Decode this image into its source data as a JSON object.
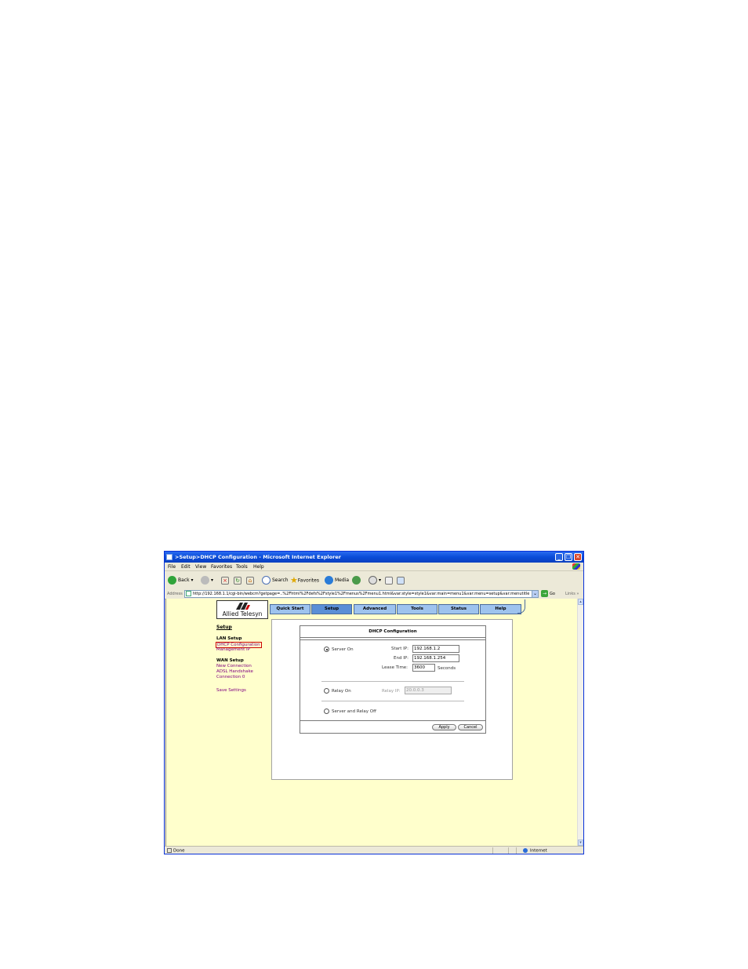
{
  "window": {
    "title": ">Setup>DHCP Configuration - Microsoft Internet Explorer",
    "minimize": "_",
    "maximize": "❐",
    "close": "✕"
  },
  "menubar": {
    "items": [
      "File",
      "Edit",
      "View",
      "Favorites",
      "Tools",
      "Help"
    ]
  },
  "toolbar": {
    "back": "Back",
    "search": "Search",
    "favorites": "Favorites",
    "media": "Media"
  },
  "address": {
    "label": "Address",
    "url": "http://192.168.1.1/cgi-bin/webcm?getpage=..%2Fhtml%2Fdefs%2Fstyle1%2Fmenus%2Fmenu1.html&var:style=style1&var:main=menu1&var:menu=setup&var:menutitle",
    "go": "Go",
    "links": "Links »"
  },
  "logo": {
    "brand": "Allied Telesyn"
  },
  "nav": {
    "tabs": [
      "Quick Start",
      "Setup",
      "Advanced",
      "Tools",
      "Status",
      "Help"
    ],
    "active_index": 1
  },
  "sidebar": {
    "title": "Setup",
    "lan_heading": "LAN Setup",
    "dhcp_link": "DHCP Configuration",
    "mgmt_link": "Management IP",
    "wan_heading": "WAN Setup",
    "new_conn": "New Connection",
    "adsl": "ADSL Handshake",
    "conn0": "Connection 0",
    "save": "Save Settings"
  },
  "dhcp": {
    "title": "DHCP Configuration",
    "server_on": "Server On",
    "start_ip_label": "Start IP:",
    "start_ip": "192.168.1.2",
    "end_ip_label": "End IP:",
    "end_ip": "192.168.1.254",
    "lease_label": "Lease Time:",
    "lease": "3600",
    "seconds": "Seconds",
    "relay_on": "Relay On",
    "relay_ip_label": "Relay IP:",
    "relay_ip": "20.0.0.3",
    "off": "Server and Relay Off",
    "apply": "Apply",
    "cancel": "Cancel",
    "selected": "server_on"
  },
  "status": {
    "done": "Done",
    "zone": "Internet"
  },
  "colors": {
    "page_bg": "#ffffcc",
    "tab": "#9ec3ee",
    "tab_active": "#5a8fd6",
    "link": "#800080",
    "titlebar": "#0a4cd8"
  }
}
